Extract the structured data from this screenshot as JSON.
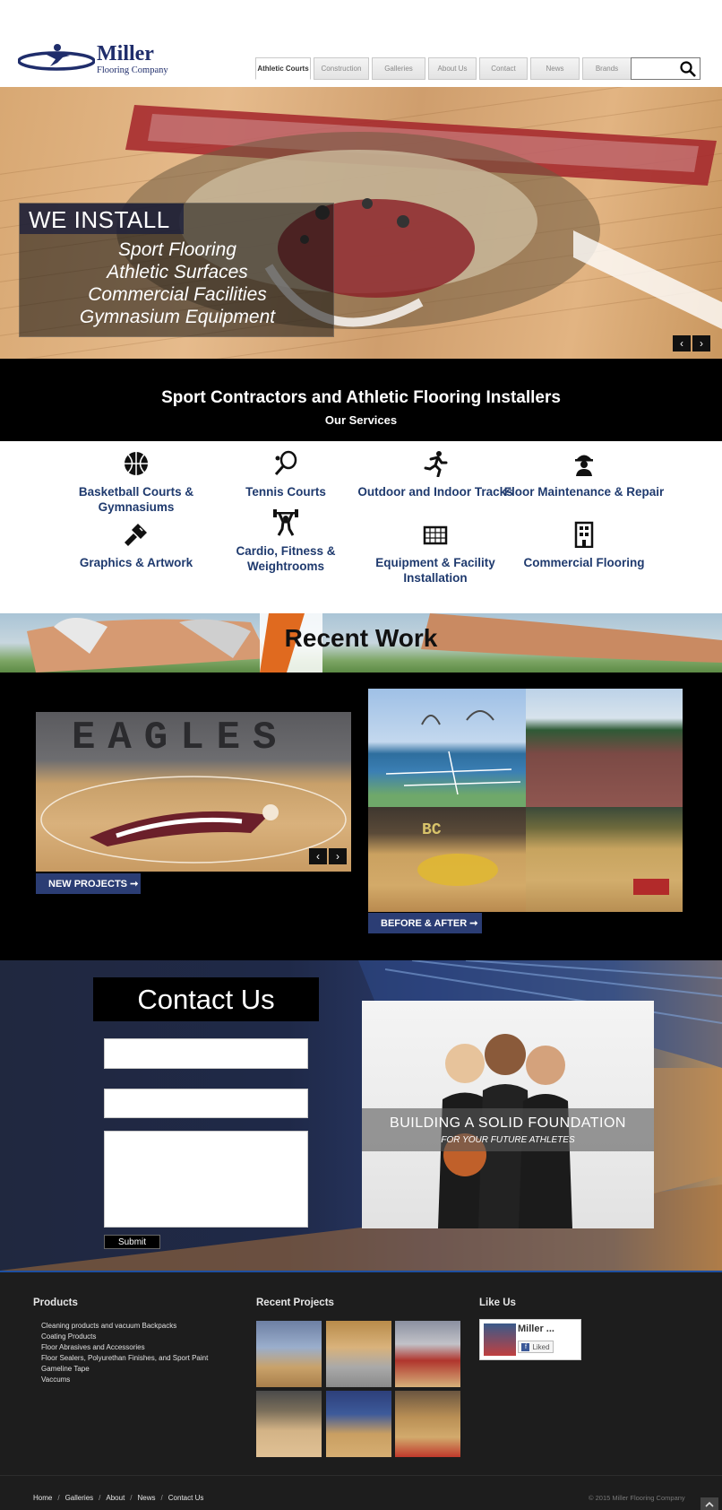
{
  "header": {
    "logo_name": "Miller",
    "logo_sub": "Flooring Company",
    "nav": [
      "Athletic Courts",
      "Construction",
      "Galleries",
      "About Us",
      "Contact",
      "News",
      "Brands"
    ],
    "search_placeholder": ""
  },
  "hero": {
    "heading": "WE INSTALL",
    "lines": [
      "Sport Flooring",
      "Athletic Surfaces",
      "Commercial Facilities",
      "Gymnasium Equipment"
    ],
    "prev": "‹",
    "next": "›"
  },
  "services": {
    "title": "Sport Contractors and Athletic Flooring Installers",
    "subtitle": "Our Services",
    "items": [
      {
        "label": "Basketball Courts & Gymnasiums",
        "icon": "basketball-icon"
      },
      {
        "label": "Tennis Courts",
        "icon": "tennis-racket-icon"
      },
      {
        "label": "Outdoor and Indoor Tracks",
        "icon": "runner-icon"
      },
      {
        "label": "Floor Maintenance & Repair",
        "icon": "worker-helmet-icon"
      },
      {
        "label": "Graphics & Artwork",
        "icon": "paint-brush-icon"
      },
      {
        "label": "Cardio, Fitness & Weightrooms",
        "icon": "weightlifter-icon"
      },
      {
        "label": "Equipment & Facility Installation",
        "icon": "goal-net-icon"
      },
      {
        "label": "Commercial Flooring",
        "icon": "building-icon"
      }
    ]
  },
  "recent": {
    "title": "Recent Work",
    "eagles_word": "EAGLES",
    "new_projects": "NEW PROJECTS ➞",
    "before_after": "BEFORE & AFTER ➞",
    "prev": "‹",
    "next": "›"
  },
  "contact": {
    "title": "Contact Us",
    "submit": "Submit",
    "photo_line1": "BUILDING A SOLID FOUNDATION",
    "photo_line2": "FOR YOUR FUTURE ATHLETES"
  },
  "footer": {
    "products_head": "Products",
    "products": [
      "Cleaning products and vacuum Backpacks",
      "Coating Products",
      "Floor Abrasives and Accessories",
      "Floor Sealers, Polyurethan Finishes, and Sport Paint",
      "Gameline Tape",
      "Vaccums"
    ],
    "recent_head": "Recent Projects",
    "like_head": "Like Us",
    "like_name": "Miller ...",
    "liked": "Liked",
    "breadcrumbs": [
      "Home",
      "Galleries",
      "About",
      "News",
      "Contact Us"
    ],
    "copyright": "© 2015 Miller Flooring Company"
  },
  "colors": {
    "brand_navy": "#1f2d6b",
    "service_blue": "#1f3a6e",
    "button_blue": "#2b3d74",
    "footer_bg": "#1d1d1d",
    "accent_line": "#1e4fa0"
  }
}
